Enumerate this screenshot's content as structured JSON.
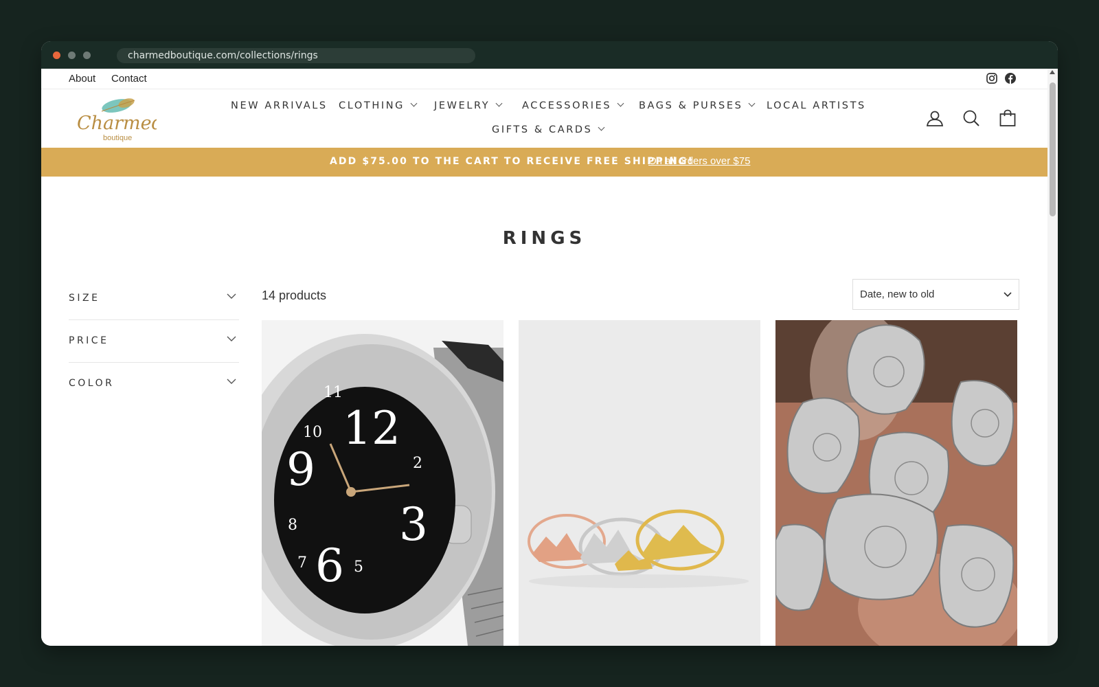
{
  "browser": {
    "url": "charmedboutique.com/collections/rings"
  },
  "utility_nav": {
    "links": [
      "About",
      "Contact"
    ],
    "social_icons": [
      "instagram-icon",
      "facebook-icon"
    ]
  },
  "logo": {
    "brand": "Charmed",
    "subtitle": "boutique"
  },
  "main_nav": {
    "items": [
      {
        "label": "NEW ARRIVALS",
        "dropdown": false
      },
      {
        "label": "CLOTHING",
        "dropdown": true
      },
      {
        "label": "JEWELRY",
        "dropdown": true
      },
      {
        "label": "ACCESSORIES",
        "dropdown": true
      },
      {
        "label": "BAGS & PURSES",
        "dropdown": true
      },
      {
        "label": "LOCAL ARTISTS",
        "dropdown": false
      },
      {
        "label": "GIFTS & CARDS",
        "dropdown": true
      }
    ]
  },
  "header_icons": [
    "account-icon",
    "search-icon",
    "cart-icon"
  ],
  "announcement": {
    "message": "ADD $75.00 TO THE CART TO RECEIVE FREE SHIPPING!",
    "link": "On all orders over $75",
    "background": "#d9ab56"
  },
  "collection": {
    "title": "RINGS",
    "product_count": "14 products",
    "sort": {
      "selected": "Date, new to old"
    }
  },
  "filters": [
    {
      "label": "SIZE"
    },
    {
      "label": "PRICE"
    },
    {
      "label": "COLOR"
    }
  ],
  "products": [
    {
      "image": "watch-ring-photo"
    },
    {
      "image": "mountain-rings-photo"
    },
    {
      "image": "spoon-rings-photo"
    }
  ],
  "colors": {
    "desktop_background": "#16241f",
    "browser_chrome": "#1a2c26",
    "accent": "#d9ab56"
  }
}
